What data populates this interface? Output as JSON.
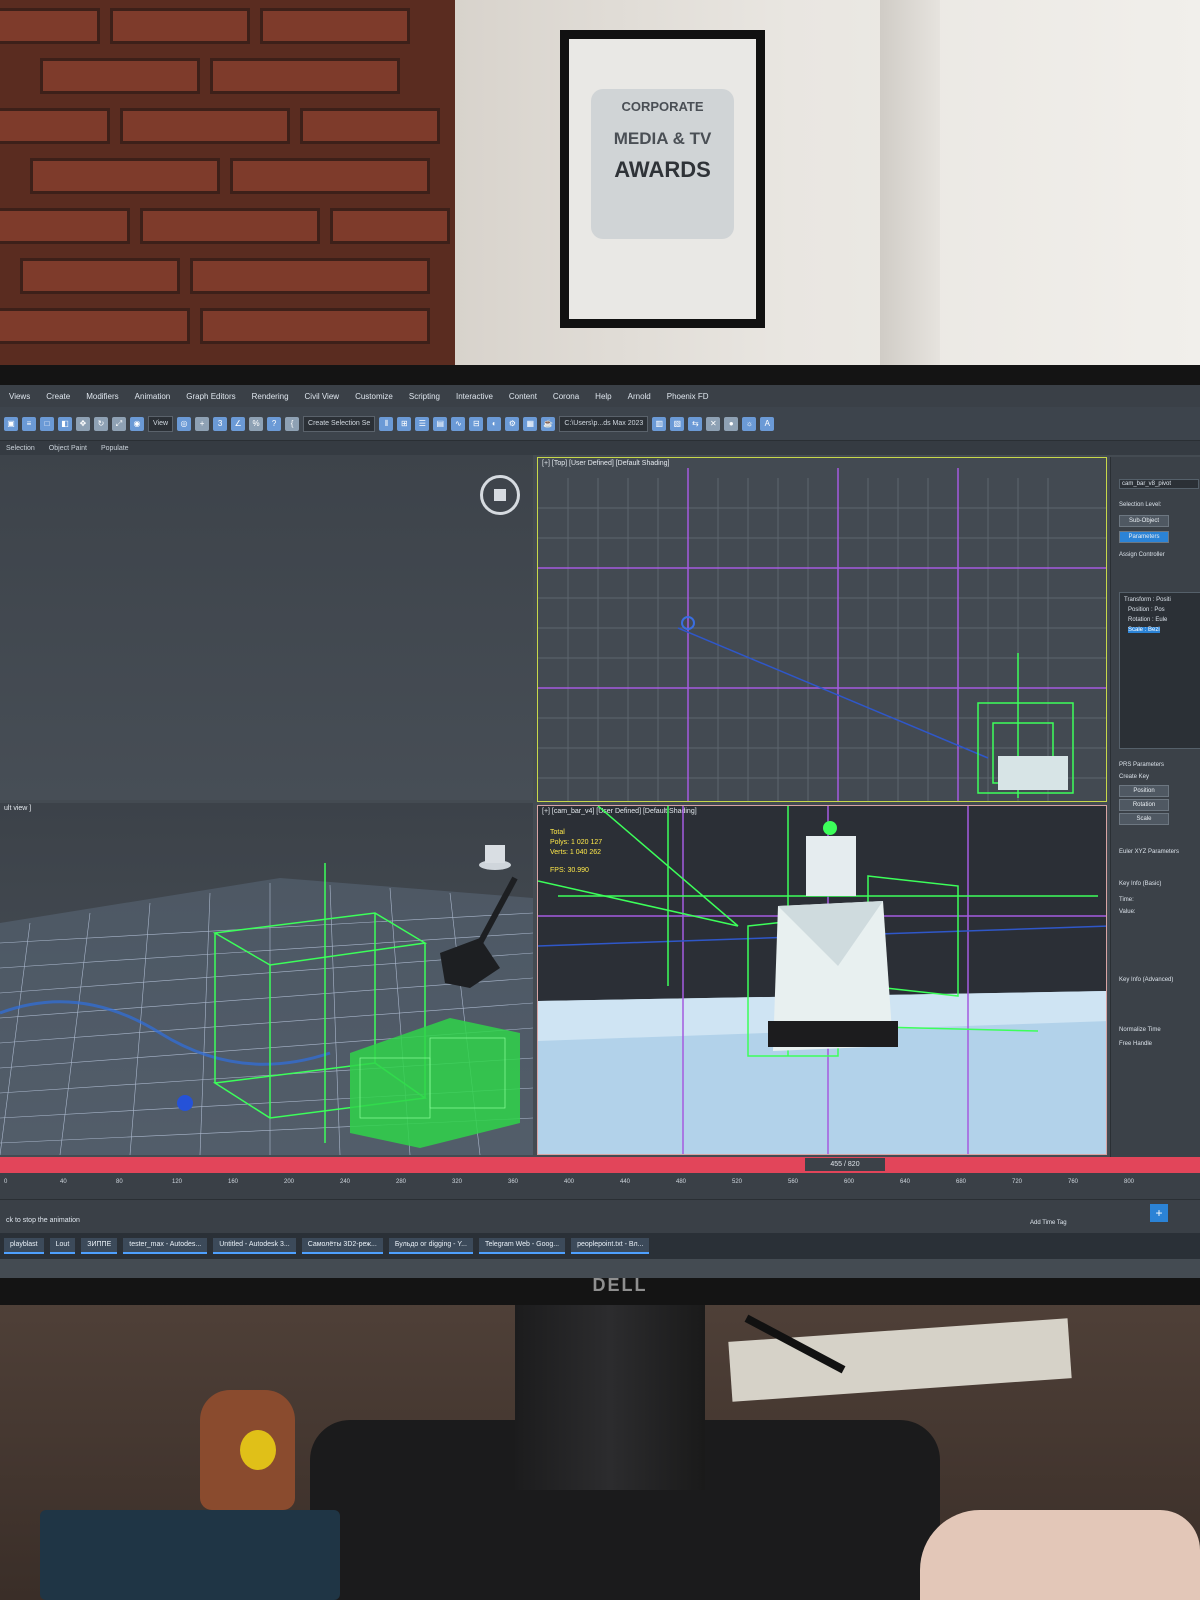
{
  "poster": {
    "line1": "CORPORATE",
    "line2": "MEDIA & TV",
    "line3": "AWARDS"
  },
  "monitor": {
    "brand": "DELL"
  },
  "app": {
    "menu": [
      "Views",
      "Create",
      "Modifiers",
      "Animation",
      "Graph Editors",
      "Rendering",
      "Civil View",
      "Customize",
      "Scripting",
      "Interactive",
      "Content",
      "Corona",
      "Help",
      "Arnold",
      "Phoenix FD"
    ],
    "toolbar": {
      "filter_value": "View",
      "selection_set": "Create Selection Se",
      "path_field": "C:\\Users\\p...ds Max 2023"
    },
    "subbar": [
      "Selection",
      "Object Paint",
      "Populate"
    ],
    "viewports": {
      "top_right_label": "[+] [Top] [User Defined] [Default Shading]",
      "bottom_left_label": "ult view ]",
      "bottom_right_label": "[+] [cam_bar_v4] [User Defined] [Default Shading]",
      "stats": {
        "total_label": "Total",
        "polys_label": "Polys:",
        "polys_value": "1 020 127",
        "verts_label": "Verts:",
        "verts_value": "1 040 262",
        "fps_label": "FPS:",
        "fps_value": "30.990"
      }
    },
    "command_panel": {
      "object_name": "cam_bar_v8_pivot",
      "section_selection": "Selection Level:",
      "btn_sub_object": "Sub-Object",
      "btn_parameters": "Parameters",
      "section_assign": "Assign Controller",
      "list_items": [
        "Transform : Positi",
        "Position : Pos",
        "Rotation : Eule",
        "Scale : Bezi"
      ],
      "section_pid": "PRS Parameters",
      "create_key": "Create Key",
      "btn_position": "Position",
      "btn_rotation": "Rotation",
      "btn_scale": "Scale",
      "section_euler": "Euler XYZ Parameters",
      "section_key_info": "Key Info (Basic)",
      "time_label": "Time:",
      "value_label": "Value:",
      "section_key_adv": "Key Info (Advanced)",
      "normalize": "Normalize Time",
      "free_handle": "Free Handle"
    },
    "timeline": {
      "thumb": "455 / 820",
      "ticks": [
        "0",
        "40",
        "80",
        "120",
        "160",
        "200",
        "240",
        "280",
        "320",
        "360",
        "400",
        "440",
        "480",
        "520",
        "560",
        "600",
        "640",
        "680",
        "720",
        "760",
        "800"
      ]
    },
    "status": {
      "hint": "ck to stop the animation",
      "add_time_tag": "Add Time Tag"
    },
    "taskbar": [
      "playblast",
      "Lout",
      "ЗИППЕ",
      "tester_max - Autodes...",
      "Untitled - Autodesk 3...",
      "Самолёты 3D2-реж...",
      "Бульдо ог digging - Y...",
      "Telegram Web - Goog...",
      "peoplepoint.txt - Bл..."
    ]
  },
  "colors": {
    "selection_green": "#3cff5a",
    "grid_purple": "#a45be0",
    "timeline_red": "#e2455a",
    "accent_blue": "#2b83d6"
  }
}
